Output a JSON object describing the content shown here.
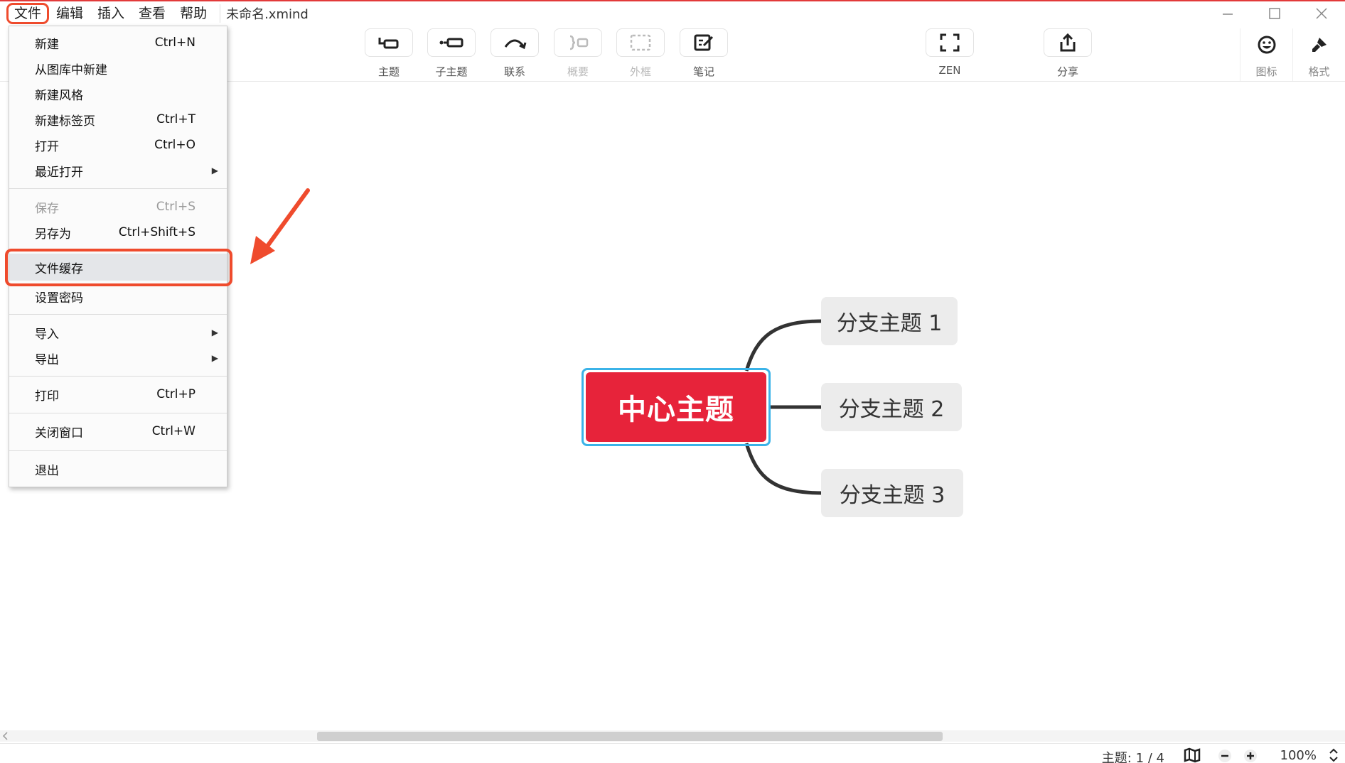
{
  "menubar": {
    "items": [
      "文件",
      "编辑",
      "插入",
      "查看",
      "帮助"
    ],
    "file_title": "未命名.xmind"
  },
  "toolbar": {
    "tools": [
      {
        "label": "主题",
        "icon": "topic-icon"
      },
      {
        "label": "子主题",
        "icon": "subtopic-icon"
      },
      {
        "label": "联系",
        "icon": "relationship-icon"
      },
      {
        "label": "概要",
        "icon": "summary-icon"
      },
      {
        "label": "外框",
        "icon": "boundary-icon"
      },
      {
        "label": "笔记",
        "icon": "note-icon"
      },
      {
        "label": "ZEN",
        "icon": "zen-icon"
      },
      {
        "label": "分享",
        "icon": "share-icon"
      }
    ],
    "right": [
      {
        "label": "图标",
        "icon": "smiley-icon"
      },
      {
        "label": "格式",
        "icon": "brush-icon"
      }
    ]
  },
  "file_menu": {
    "items": [
      {
        "label": "新建",
        "shortcut": "Ctrl+N"
      },
      {
        "label": "从图库中新建",
        "shortcut": ""
      },
      {
        "label": "新建风格",
        "shortcut": ""
      },
      {
        "label": "新建标签页",
        "shortcut": "Ctrl+T"
      },
      {
        "label": "打开",
        "shortcut": "Ctrl+O"
      },
      {
        "label": "最近打开",
        "shortcut": ""
      },
      {
        "label": "保存",
        "shortcut": "Ctrl+S"
      },
      {
        "label": "另存为",
        "shortcut": "Ctrl+Shift+S"
      },
      {
        "label": "文件缓存",
        "shortcut": ""
      },
      {
        "label": "设置密码",
        "shortcut": ""
      },
      {
        "label": "导入",
        "shortcut": ""
      },
      {
        "label": "导出",
        "shortcut": ""
      },
      {
        "label": "打印",
        "shortcut": "Ctrl+P"
      },
      {
        "label": "关闭窗口",
        "shortcut": "Ctrl+W"
      },
      {
        "label": "退出",
        "shortcut": ""
      }
    ]
  },
  "mindmap": {
    "central_topic": "中心主题",
    "branches": [
      "分支主题 1",
      "分支主题 2",
      "分支主题 3"
    ]
  },
  "status": {
    "topics": "主题: 1 / 4",
    "zoom": "100%"
  },
  "colors": {
    "accent": "#e7233a",
    "highlight": "#ef4b2d",
    "selection": "#3bb3e8"
  }
}
